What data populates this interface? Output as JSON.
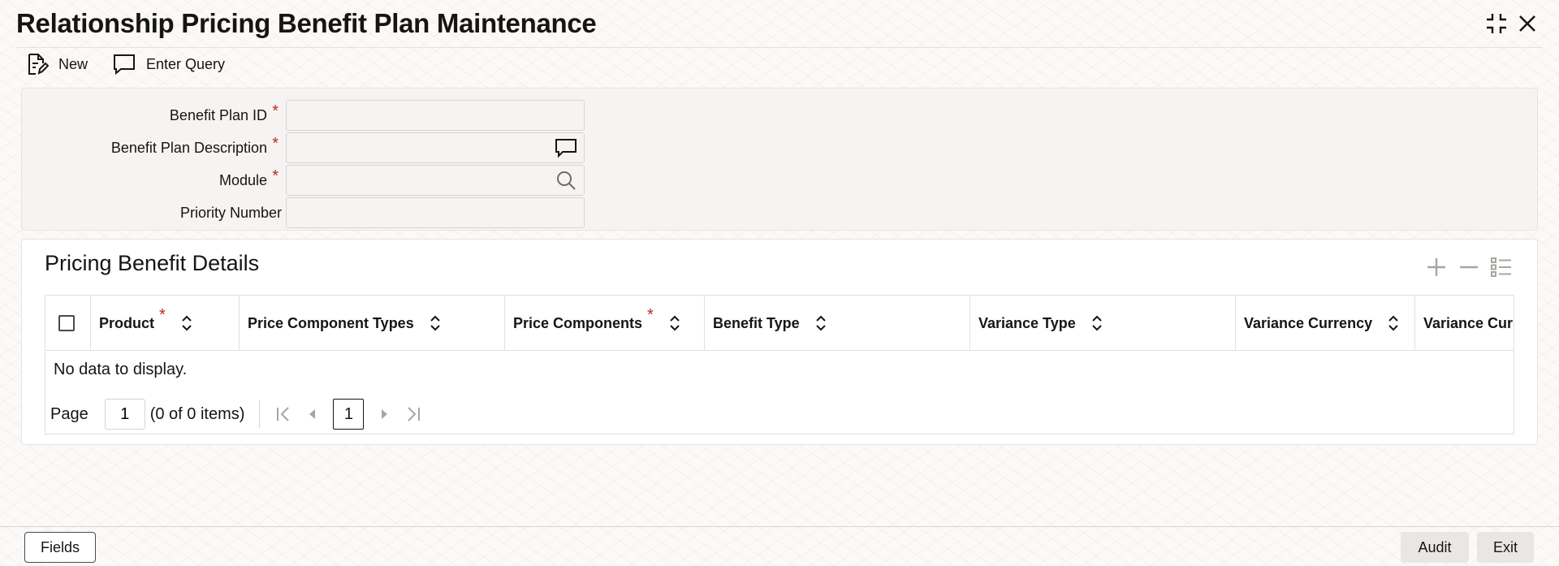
{
  "window": {
    "title": "Relationship Pricing Benefit Plan Maintenance",
    "collapse_icon": "collapse-icon",
    "close_icon": "close-icon"
  },
  "toolbar": {
    "new_label": "New",
    "enter_query_label": "Enter Query"
  },
  "form": {
    "benefit_plan_id": {
      "label": "Benefit Plan ID",
      "required": "*",
      "value": ""
    },
    "benefit_plan_description": {
      "label": "Benefit Plan Description",
      "required": "*",
      "value": ""
    },
    "module": {
      "label": "Module",
      "required": "*",
      "value": ""
    },
    "priority_number": {
      "label": "Priority Number",
      "value": ""
    }
  },
  "details": {
    "title": "Pricing Benefit Details",
    "columns": [
      {
        "label": "Product",
        "required": "*"
      },
      {
        "label": "Price Component Types",
        "required": ""
      },
      {
        "label": "Price Components",
        "required": "*"
      },
      {
        "label": "Benefit Type",
        "required": ""
      },
      {
        "label": "Variance Type",
        "required": ""
      },
      {
        "label": "Variance Currency",
        "required": ""
      },
      {
        "label": "Variance Curre",
        "required": ""
      }
    ],
    "empty_message": "No data to display.",
    "pager": {
      "page_label": "Page",
      "page_value": "1",
      "count_text": "(0 of 0 items)",
      "current_page": "1"
    }
  },
  "footer": {
    "fields_label": "Fields",
    "audit_label": "Audit",
    "exit_label": "Exit"
  },
  "colors": {
    "required": "#c0262d",
    "text": "#161513",
    "panel_bg": "#f5f4f2"
  }
}
